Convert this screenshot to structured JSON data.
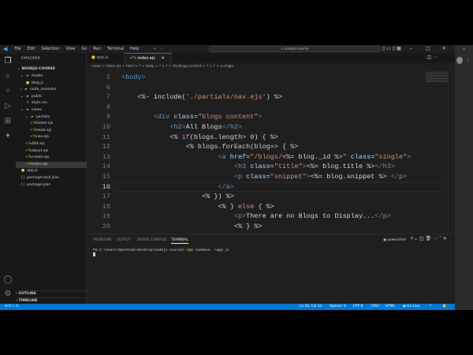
{
  "menu": [
    "File",
    "Edit",
    "Selection",
    "View",
    "Go",
    "Run",
    "Terminal",
    "Help"
  ],
  "search_text": "nodejs-course",
  "explorer": {
    "title": "EXPLORER",
    "project": "NODEJS-COURSE",
    "items": [
      {
        "label": "model",
        "type": "folder",
        "depth": 1,
        "open": true
      },
      {
        "label": "blog.js",
        "type": "js",
        "depth": 2
      },
      {
        "label": "node_modules",
        "type": "folder",
        "depth": 1,
        "open": false
      },
      {
        "label": "public",
        "type": "folder",
        "depth": 1,
        "open": true
      },
      {
        "label": "style.css",
        "type": "css",
        "depth": 2
      },
      {
        "label": "views",
        "type": "folder",
        "depth": 1,
        "open": true
      },
      {
        "label": "partials",
        "type": "folder",
        "depth": 2,
        "open": true
      },
      {
        "label": "footer.ejs",
        "type": "ejs",
        "depth": 3
      },
      {
        "label": "head.ejs",
        "type": "ejs",
        "depth": 3
      },
      {
        "label": "nav.ejs",
        "type": "ejs",
        "depth": 3
      },
      {
        "label": "404.ejs",
        "type": "ejs",
        "depth": 2
      },
      {
        "label": "about.ejs",
        "type": "ejs",
        "depth": 2
      },
      {
        "label": "create.ejs",
        "type": "ejs",
        "depth": 2
      },
      {
        "label": "index.ejs",
        "type": "ejs",
        "depth": 2,
        "selected": true
      },
      {
        "label": "app.js",
        "type": "js",
        "depth": 1
      },
      {
        "label": "package-lock.json",
        "type": "json",
        "depth": 1
      },
      {
        "label": "package.json",
        "type": "json",
        "depth": 1
      }
    ],
    "outline": "OUTLINE",
    "timeline": "TIMELINE"
  },
  "tabs": [
    {
      "label": "app.js",
      "icon": "js"
    },
    {
      "label": "index.ejs",
      "icon": "ejs",
      "active": true
    }
  ],
  "breadcrumb": "views > index.ejs > html > ? > body > ? > ? > div.blogs.content > ? > ? > a.single",
  "editor": {
    "current_line": 16,
    "lines": [
      {
        "n": 5,
        "indent": 0,
        "tokens": [
          [
            "<",
            "g"
          ],
          [
            "body",
            "t"
          ],
          [
            ">",
            "g"
          ]
        ]
      },
      {
        "n": 6,
        "indent": 0,
        "tokens": []
      },
      {
        "n": 7,
        "indent": 4,
        "tokens": [
          [
            "<%- include(",
            "x"
          ],
          [
            "'./partials/nav.ejs'",
            "s"
          ],
          [
            ") %>",
            "x"
          ]
        ]
      },
      {
        "n": 8,
        "indent": 0,
        "tokens": []
      },
      {
        "n": 9,
        "indent": 8,
        "tokens": [
          [
            "<",
            "g"
          ],
          [
            "div",
            "t"
          ],
          [
            " class",
            "a"
          ],
          [
            "=",
            "x"
          ],
          [
            "\"blogs content\"",
            "s"
          ],
          [
            ">",
            "g"
          ]
        ]
      },
      {
        "n": 10,
        "indent": 12,
        "tokens": [
          [
            "<",
            "g"
          ],
          [
            "h2",
            "t"
          ],
          [
            ">",
            "g"
          ],
          [
            "All Blogs",
            "x"
          ],
          [
            "</",
            "g"
          ],
          [
            "h2",
            "t"
          ],
          [
            ">",
            "g"
          ]
        ]
      },
      {
        "n": 11,
        "indent": 12,
        "tokens": [
          [
            "<% ",
            "x"
          ],
          [
            "if",
            "k"
          ],
          [
            "(blogs.length> 0) { %>",
            "x"
          ]
        ]
      },
      {
        "n": 12,
        "indent": 16,
        "tokens": [
          [
            "<% blogs.forEach(blog=> { %>",
            "x"
          ]
        ]
      },
      {
        "n": 13,
        "indent": 24,
        "tokens": [
          [
            "<",
            "g"
          ],
          [
            "a",
            "t"
          ],
          [
            " href",
            "a"
          ],
          [
            "=",
            "x"
          ],
          [
            "\"/blogs/",
            "s"
          ],
          [
            "<%= blog._id %>",
            "x"
          ],
          [
            "\"",
            "s"
          ],
          [
            " class",
            "a"
          ],
          [
            "=",
            "x"
          ],
          [
            "\"single\"",
            "s"
          ],
          [
            ">",
            "g"
          ]
        ]
      },
      {
        "n": 14,
        "indent": 28,
        "tokens": [
          [
            "<",
            "g"
          ],
          [
            "h3",
            "t"
          ],
          [
            " class",
            "a"
          ],
          [
            "=",
            "x"
          ],
          [
            "\"title\"",
            "s"
          ],
          [
            ">",
            "g"
          ],
          [
            "<%= blog.title %>",
            "x"
          ],
          [
            "</",
            "g"
          ],
          [
            "h3",
            "t"
          ],
          [
            ">",
            "g"
          ]
        ]
      },
      {
        "n": 15,
        "indent": 28,
        "tokens": [
          [
            "<",
            "g"
          ],
          [
            "p",
            "t"
          ],
          [
            " class",
            "a"
          ],
          [
            "=",
            "x"
          ],
          [
            "\"snippet\"",
            "s"
          ],
          [
            ">",
            "g"
          ],
          [
            "<%= blog.snippet %> ",
            "x"
          ],
          [
            "</",
            "g"
          ],
          [
            "p",
            "t"
          ],
          [
            ">",
            "g"
          ]
        ]
      },
      {
        "n": 16,
        "indent": 24,
        "tokens": [
          [
            "</",
            "g"
          ],
          [
            "a",
            "t"
          ],
          [
            ">",
            "g"
          ]
        ]
      },
      {
        "n": 17,
        "indent": 20,
        "tokens": [
          [
            "<% }) %>",
            "x"
          ]
        ]
      },
      {
        "n": 18,
        "indent": 24,
        "tokens": [
          [
            "<% } ",
            "x"
          ],
          [
            "else",
            "k"
          ],
          [
            " { %>",
            "x"
          ]
        ]
      },
      {
        "n": 19,
        "indent": 28,
        "tokens": [
          [
            "<",
            "g"
          ],
          [
            "p",
            "t"
          ],
          [
            ">",
            "g"
          ],
          [
            "There are no Blogs to Display...",
            "x"
          ],
          [
            "</",
            "g"
          ],
          [
            "p",
            "t"
          ],
          [
            ">",
            "g"
          ]
        ]
      },
      {
        "n": 20,
        "indent": 28,
        "tokens": [
          [
            "<% } %>",
            "x"
          ]
        ]
      }
    ]
  },
  "panel": {
    "tabs": [
      "PROBLEMS",
      "OUTPUT",
      "DEBUG CONSOLE",
      "TERMINAL"
    ],
    "active_tab": "TERMINAL",
    "shell": "powershell",
    "prompt": "PS C:\\Users\\OpenCode\\Desktop\\nodejs-course> ",
    "cmd": "npm",
    "args": " nodemon .\\app.js"
  },
  "status": {
    "errors": "0",
    "warnings": "0",
    "position": "Ln 16, Col 33",
    "spaces": "Spaces: 4",
    "encoding": "UTF-8",
    "eol": "CRLF",
    "language": "HTML",
    "golive": "Go Live"
  }
}
